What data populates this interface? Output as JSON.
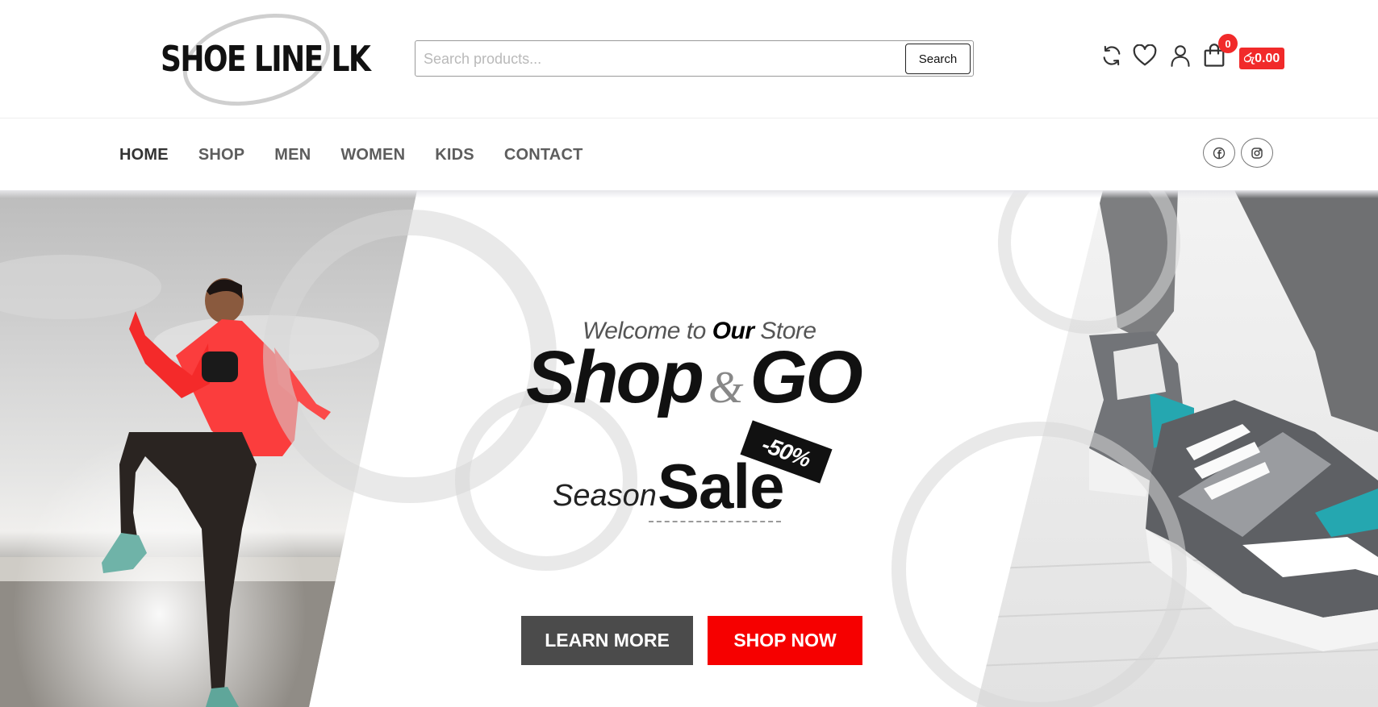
{
  "header": {
    "logo_text": "SHOE LINE LK",
    "search": {
      "placeholder": "Search products...",
      "button_label": "Search"
    },
    "icons": [
      "compare-icon",
      "heart-icon",
      "user-icon",
      "shopping-bag-icon"
    ],
    "cart": {
      "count": "0",
      "total": "රු0.00"
    }
  },
  "nav": {
    "items": [
      {
        "label": "HOME",
        "active": true
      },
      {
        "label": "SHOP"
      },
      {
        "label": "MEN"
      },
      {
        "label": "WOMEN"
      },
      {
        "label": "KIDS"
      },
      {
        "label": "CONTACT"
      }
    ],
    "social": [
      "facebook-icon",
      "instagram-icon"
    ]
  },
  "hero": {
    "welcome_prefix": "Welcome to",
    "welcome_bold": "Our",
    "welcome_suffix": "Store",
    "headline_left": "Shop",
    "headline_amp": "&",
    "headline_right": "GO",
    "season": "Season",
    "sale": "Sale",
    "discount": "-50%",
    "learn_more": "LEARN MORE",
    "shop_now": "SHOP NOW"
  },
  "colors": {
    "accent": "#f60000",
    "badge": "#f12a2a",
    "dark_button": "#4b4b4b"
  }
}
